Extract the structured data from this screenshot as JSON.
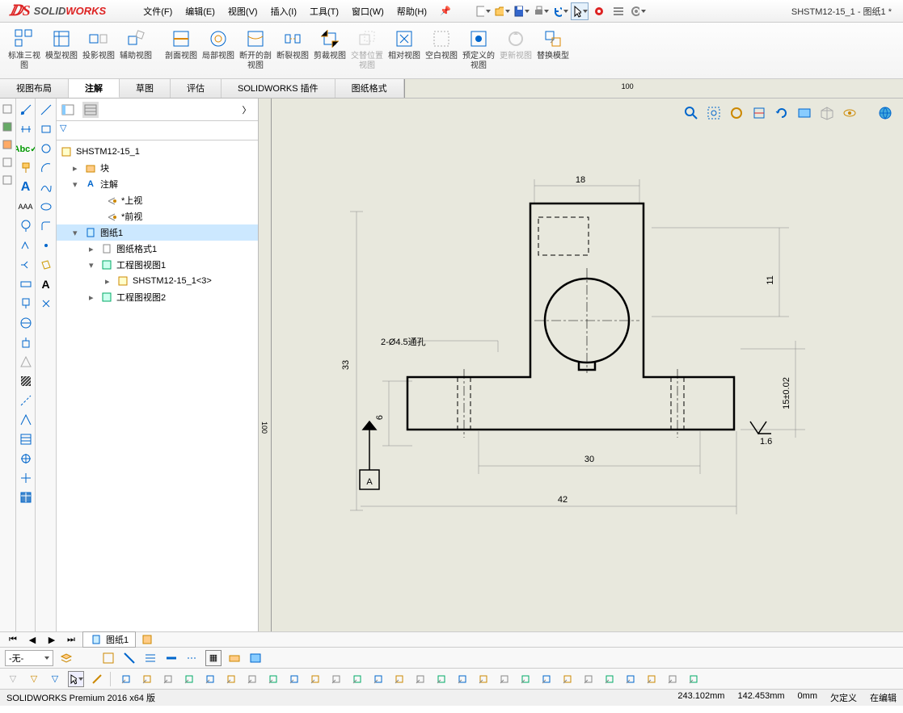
{
  "app": {
    "name_solid": "SOLID",
    "name_works": "WORKS",
    "title": "SHSTM12-15_1 - 图纸1 *"
  },
  "menu": {
    "file": "文件(F)",
    "edit": "编辑(E)",
    "view": "视图(V)",
    "insert": "插入(I)",
    "tools": "工具(T)",
    "window": "窗口(W)",
    "help": "帮助(H)"
  },
  "ribbon": {
    "std3view": "标准三视图",
    "modelview": "模型视图",
    "projview": "投影视图",
    "auxview": "辅助视图",
    "sectionview": "剖面视图",
    "localview": "局部视图",
    "brokensection": "断开的剖视图",
    "breakview": "断裂视图",
    "cropview": "剪裁视图",
    "altpos": "交替位置视图",
    "relview": "相对视图",
    "emptyview": "空白视图",
    "predefview": "预定义的视图",
    "updateview": "更新视图",
    "replacemodel": "替换模型"
  },
  "tabs": {
    "viewlayout": "视图布局",
    "annotation": "注解",
    "sketch": "草图",
    "evaluate": "评估",
    "swaddins": "SOLIDWORKS 插件",
    "sheetformat": "图纸格式"
  },
  "tree": {
    "root": "SHSTM12-15_1",
    "blocks": "块",
    "annotations": "注解",
    "topview": "*上视",
    "frontview": "*前视",
    "sheet1": "图纸1",
    "sheetformat1": "图纸格式1",
    "drawview1": "工程图视图1",
    "partref": "SHSTM12-15_1<3>",
    "drawview2": "工程图视图2"
  },
  "ruler": {
    "h": "100",
    "v": "100"
  },
  "dims": {
    "d18": "18",
    "d33": "33",
    "d11": "11",
    "d6": "6",
    "d30": "30",
    "d42": "42",
    "d15": "15±0.02",
    "hole": "2-Ø4.5通孔",
    "ra": "1.6",
    "datumA": "A"
  },
  "sheet": {
    "tab1": "图纸1"
  },
  "layer": {
    "none": "-无-"
  },
  "status": {
    "version": "SOLIDWORKS Premium 2016 x64 版",
    "x": "243.102mm",
    "y": "142.453mm",
    "z": "0mm",
    "sel": "欠定义",
    "mode": "在编辑"
  }
}
